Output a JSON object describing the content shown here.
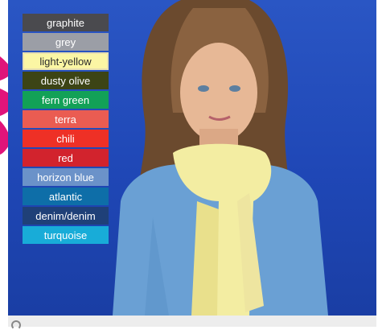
{
  "swatches": [
    {
      "label": "graphite",
      "color": "#4a4a4e"
    },
    {
      "label": "grey",
      "color": "#9b9ea6"
    },
    {
      "label": "light-yellow",
      "color": "#fbf6a4",
      "selected": true
    },
    {
      "label": "dusty olive",
      "color": "#3c4415"
    },
    {
      "label": "fern green",
      "color": "#12a157"
    },
    {
      "label": "terra",
      "color": "#ea5c52"
    },
    {
      "label": "chili",
      "color": "#ee3026"
    },
    {
      "label": "red",
      "color": "#d2232d"
    },
    {
      "label": "horizon blue",
      "color": "#6b92c9"
    },
    {
      "label": "atlantic",
      "color": "#0e6ea8"
    },
    {
      "label": "denim/denim",
      "color": "#1f4078"
    },
    {
      "label": "turquoise",
      "color": "#18acd8"
    }
  ],
  "colors": {
    "backdrop": "#2150bf",
    "scarf": "#f3eda2",
    "shirt": "#6aa0d4",
    "accent_splash": "#e0147a"
  }
}
